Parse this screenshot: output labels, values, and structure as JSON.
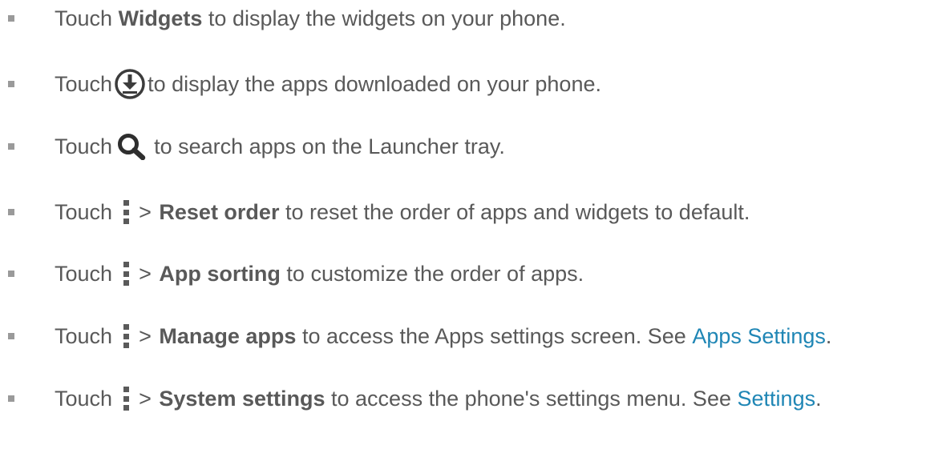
{
  "items": [
    {
      "touch": "Touch",
      "bold": "Widgets",
      "rest": "to display the widgets on your phone."
    },
    {
      "touch": "Touch",
      "icon": "download-circle-icon",
      "rest": "to display the apps downloaded on your phone."
    },
    {
      "touch": "Touch",
      "icon": "search-icon",
      "rest": "to search apps on the Launcher tray."
    },
    {
      "touch": "Touch",
      "icon": "menu-dots-icon",
      "arrow": ">",
      "bold": "Reset order",
      "rest": "to reset the order of apps and widgets to default."
    },
    {
      "touch": "Touch",
      "icon": "menu-dots-icon",
      "arrow": ">",
      "bold": "App sorting",
      "rest": "to customize the order of apps."
    },
    {
      "touch": "Touch",
      "icon": "menu-dots-icon",
      "arrow": ">",
      "bold": "Manage apps",
      "rest": "to access the Apps settings screen. See",
      "link": "Apps Settings",
      "end": "."
    },
    {
      "touch": "Touch",
      "icon": "menu-dots-icon",
      "arrow": ">",
      "bold": "System settings",
      "rest": "to access the phone's settings menu. See",
      "link": "Settings",
      "end": "."
    }
  ],
  "colors": {
    "text": "#595959",
    "link": "#1f86b5",
    "bullet": "#9a9a9a",
    "icon": "#3c3c3c"
  }
}
